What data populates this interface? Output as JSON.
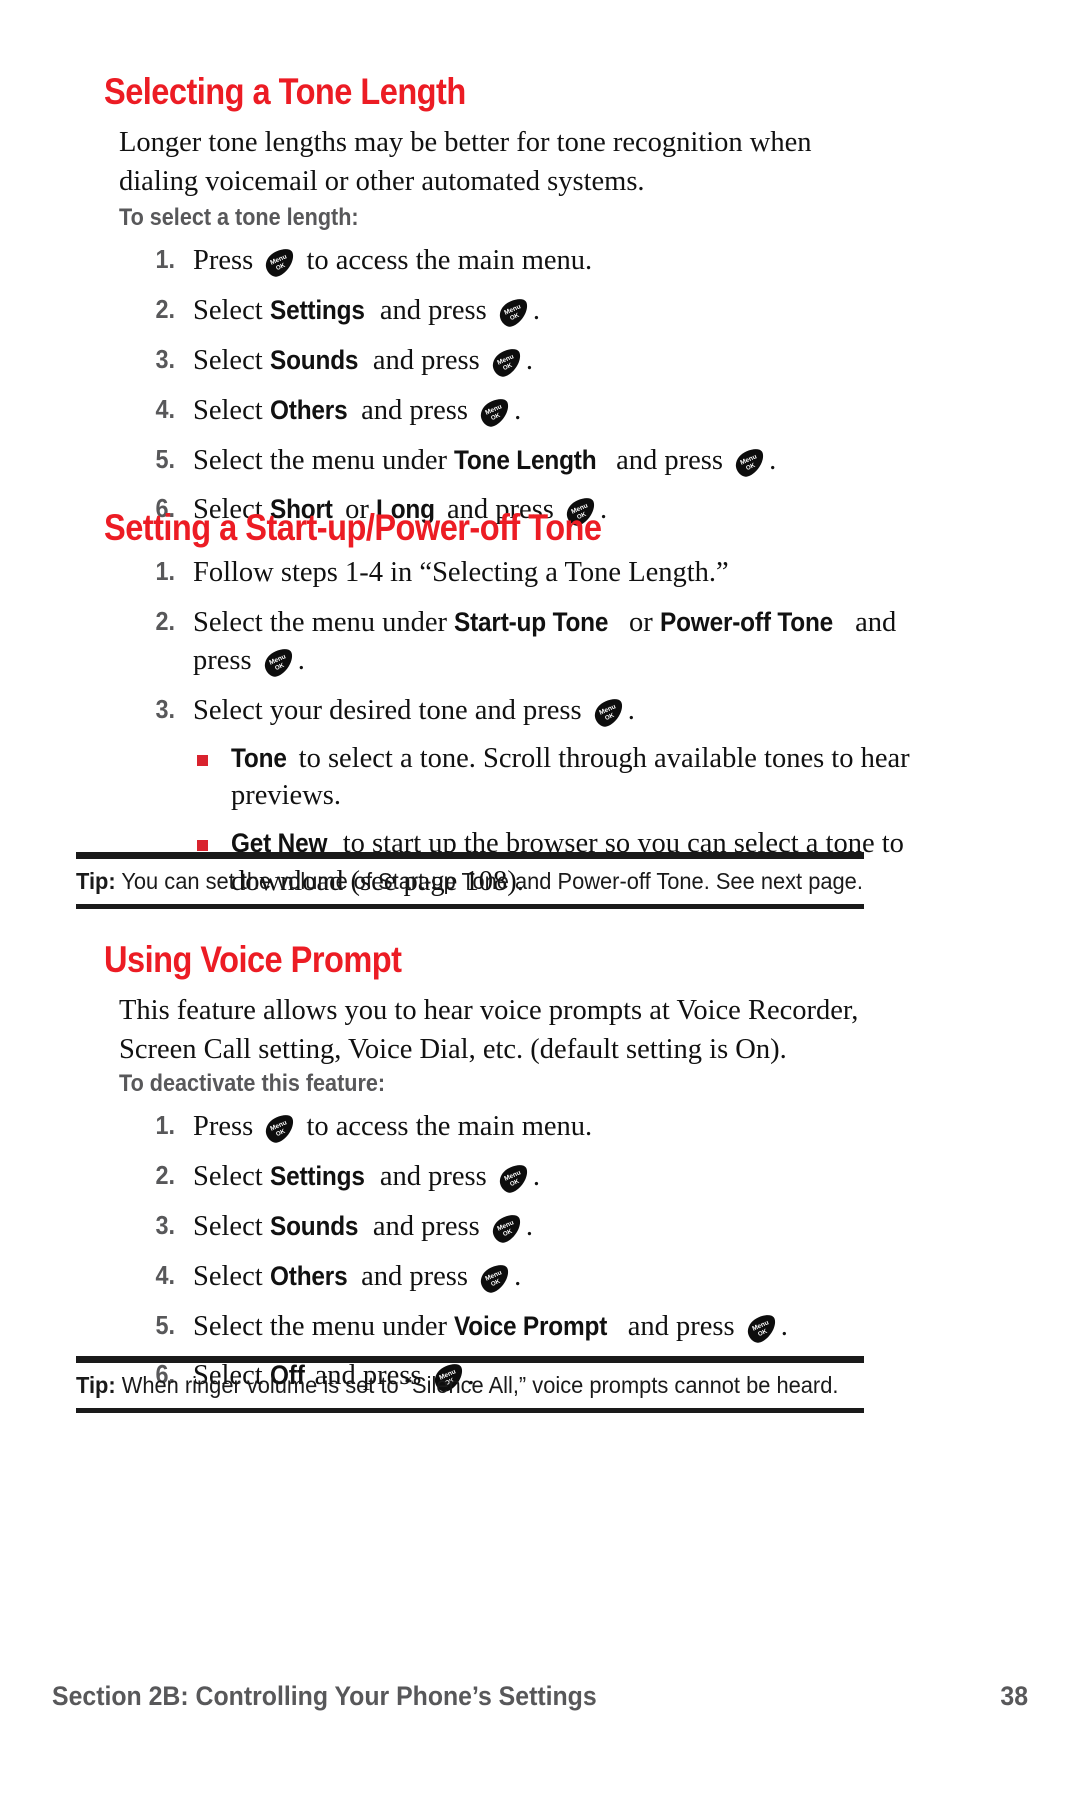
{
  "colors": {
    "heading_red": "#ec1c24",
    "bullet_red": "#d9232e",
    "subheading_gray": "#58585a",
    "rule_black": "#1a1a1a"
  },
  "icons": {
    "menu_ok_key": {
      "name": "menu-ok-key-icon",
      "line1": "Menu",
      "line2": "OK"
    }
  },
  "sections": [
    {
      "heading": "Selecting a Tone Length",
      "intro": "Longer tone lengths may be better for tone recognition when dialing voicemail or other automated systems.",
      "subheading": "To select a tone length:",
      "steps": [
        {
          "num": "1.",
          "pre": "Press ",
          "post": " to access the main menu.",
          "icon": true
        },
        {
          "num": "2.",
          "pre": "Select ",
          "bold": "Settings",
          "mid": " and press ",
          "post": ".",
          "icon": true
        },
        {
          "num": "3.",
          "pre": "Select ",
          "bold": "Sounds",
          "mid": " and press ",
          "post": ".",
          "icon": true
        },
        {
          "num": "4.",
          "pre": "Select ",
          "bold": "Others",
          "mid": " and press ",
          "post": ".",
          "icon": true
        },
        {
          "num": "5.",
          "pre": "Select the menu under ",
          "bold": "Tone Length",
          "mid": " and press ",
          "post": ".",
          "icon": true
        },
        {
          "num": "6.",
          "pre": "Select ",
          "bold": "Short",
          "mid2": " or ",
          "bold2": "Long",
          "mid": " and press ",
          "post": ".",
          "icon": true
        }
      ]
    },
    {
      "heading": "Setting a Start-up/Power-off Tone",
      "steps": [
        {
          "num": "1.",
          "pre": "Follow steps 1-4 in “Selecting a Tone Length.”",
          "icon": false
        },
        {
          "num": "2.",
          "pre": "Select the menu under ",
          "bold": "Start-up Tone",
          "mid2": " or ",
          "bold2": "Power-off Tone",
          "mid": " and press ",
          "post": ".",
          "icon": true
        },
        {
          "num": "3.",
          "pre": "Select your desired tone and press ",
          "post": ".",
          "icon": true
        }
      ],
      "bullets": [
        {
          "bold": "Tone",
          "text": " to select a tone. Scroll through available tones to hear previews."
        },
        {
          "bold": "Get New",
          "text": " to start up the browser so you can select a tone to download (see page 108)."
        }
      ]
    },
    {
      "heading": "Using Voice Prompt",
      "intro": "This feature allows you to hear voice prompts at Voice Recorder, Screen Call setting, Voice Dial, etc. (default setting is On).",
      "subheading": "To deactivate this feature:",
      "steps": [
        {
          "num": "1.",
          "pre": "Press ",
          "post": " to access the main menu.",
          "icon": true
        },
        {
          "num": "2.",
          "pre": "Select ",
          "bold": "Settings",
          "mid": " and press ",
          "post": ".",
          "icon": true
        },
        {
          "num": "3.",
          "pre": "Select ",
          "bold": "Sounds",
          "mid": " and press ",
          "post": ".",
          "icon": true
        },
        {
          "num": "4.",
          "pre": "Select ",
          "bold": "Others",
          "mid": " and press ",
          "post": ".",
          "icon": true
        },
        {
          "num": "5.",
          "pre": "Select the menu under ",
          "bold": "Voice Prompt",
          "mid": " and press ",
          "post": ".",
          "icon": true
        },
        {
          "num": "6.",
          "pre": "Select ",
          "bold": "Off",
          "mid": " and press ",
          "post": ".",
          "icon": true
        }
      ]
    }
  ],
  "tips": [
    {
      "label": "Tip:",
      "text": " You can set the volume of Start-up Tone and Power-off Tone. See next page."
    },
    {
      "label": "Tip:",
      "text": " When ringer volume is set to “Silence All,” voice prompts cannot be heard."
    }
  ],
  "footer": {
    "left": "Section 2B: Controlling Your Phone’s Settings",
    "page": "38"
  }
}
